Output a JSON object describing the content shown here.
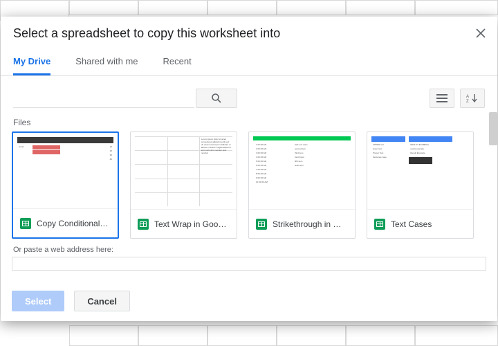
{
  "modal": {
    "title": "Select a spreadsheet to copy this worksheet into"
  },
  "tabs": [
    {
      "label": "My Drive",
      "active": true
    },
    {
      "label": "Shared with me",
      "active": false
    },
    {
      "label": "Recent",
      "active": false
    }
  ],
  "section_label": "Files",
  "files": [
    {
      "name": "Copy Conditional…",
      "selected": true
    },
    {
      "name": "Text Wrap in Goo…",
      "selected": false
    },
    {
      "name": "Strikethrough in …",
      "selected": false
    },
    {
      "name": "Text Cases",
      "selected": false
    }
  ],
  "paste": {
    "label": "Or paste a web address here:",
    "value": ""
  },
  "buttons": {
    "select": "Select",
    "cancel": "Cancel"
  },
  "icons": {
    "close": "close-icon",
    "search": "search-icon",
    "list_view": "list-view-icon",
    "sort": "sort-az-icon"
  }
}
